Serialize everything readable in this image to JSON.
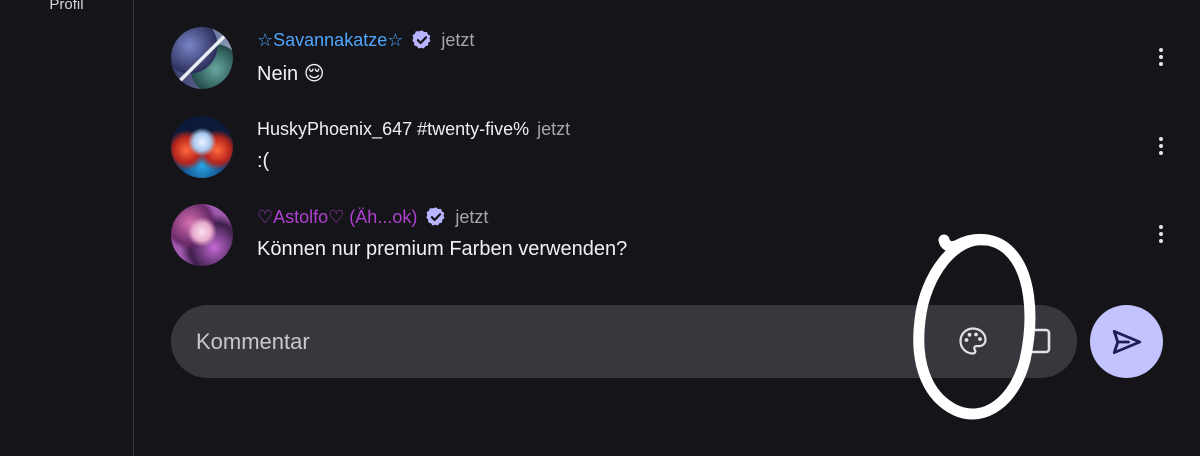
{
  "sidebar": {
    "label": "Profil"
  },
  "comments": [
    {
      "username": "☆Savannakatze☆",
      "verified": true,
      "time": "jetzt",
      "text": "Nein 😌",
      "name_color": "#4ea6ff"
    },
    {
      "username": "HuskyPhoenix_647 #twenty-five%",
      "verified": false,
      "time": "jetzt",
      "text": ":(",
      "name_color": "#f0eef4"
    },
    {
      "username": "♡Astolfo♡ (Äh...ok)",
      "verified": true,
      "time": "jetzt",
      "text": "Können nur premium Farben verwenden?",
      "name_color": "#b040d0"
    }
  ],
  "comment_input": {
    "placeholder": "Kommentar"
  },
  "icons": {
    "verified": "verified-badge-icon",
    "more": "more-vertical-icon",
    "palette": "palette-icon",
    "image": "image-icon",
    "send": "send-icon"
  },
  "colors": {
    "background": "#151419",
    "input_background": "#38373d",
    "send_button": "#c2c3ff",
    "verified_badge": "#b8b4ff"
  }
}
